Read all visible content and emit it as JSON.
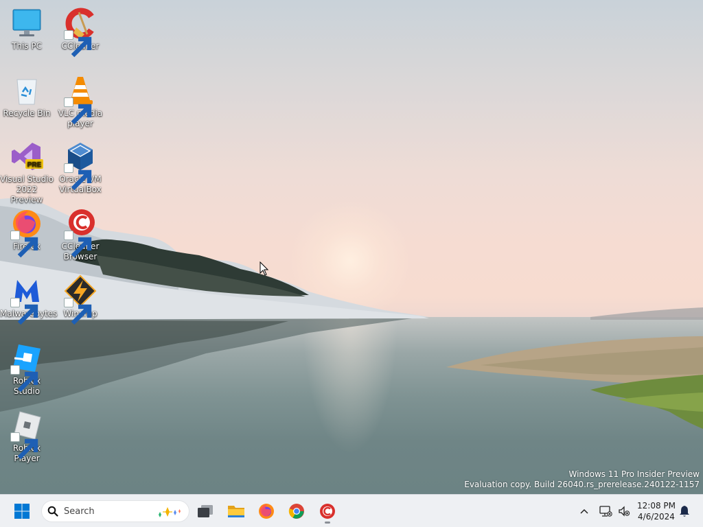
{
  "desktop": {
    "icons": [
      {
        "label": "This PC",
        "icon": "monitor-icon"
      },
      {
        "label": "CCleaner",
        "icon": "ccleaner-icon"
      },
      {
        "label": "Recycle Bin",
        "icon": "recycle-bin-icon"
      },
      {
        "label": "VLC media player",
        "icon": "vlc-icon"
      },
      {
        "label": "Visual Studio 2022 Preview",
        "icon": "visual-studio-icon",
        "badge": "PRE"
      },
      {
        "label": "Oracle VM VirtualBox",
        "icon": "virtualbox-icon"
      },
      {
        "label": "Firefox",
        "icon": "firefox-icon"
      },
      {
        "label": "CCleaner Browser",
        "icon": "ccleaner-browser-icon"
      },
      {
        "label": "Malwarebytes",
        "icon": "malwarebytes-icon"
      },
      {
        "label": "Winamp",
        "icon": "winamp-icon"
      },
      {
        "label": "Roblox Studio",
        "icon": "roblox-studio-icon"
      },
      {
        "label": "Roblox Player",
        "icon": "roblox-player-icon"
      }
    ]
  },
  "watermark": {
    "line1": "Windows 11 Pro Insider Preview",
    "line2": "Evaluation copy. Build 26040.rs_prerelease.240122-1157"
  },
  "taskbar": {
    "search_placeholder": "Search",
    "pinned": [
      {
        "name": "task-view",
        "icon": "task-view-icon"
      },
      {
        "name": "file-explorer",
        "icon": "folder-icon"
      },
      {
        "name": "firefox",
        "icon": "firefox-icon"
      },
      {
        "name": "chrome",
        "icon": "chrome-icon"
      },
      {
        "name": "ccleaner-browser",
        "icon": "ccleaner-browser-icon",
        "running": true
      }
    ],
    "tray": {
      "time": "12:08 PM",
      "date": "4/6/2024"
    }
  },
  "colors": {
    "taskbar_bg": "#eef0f3",
    "windows_blue": "#0078d4"
  }
}
